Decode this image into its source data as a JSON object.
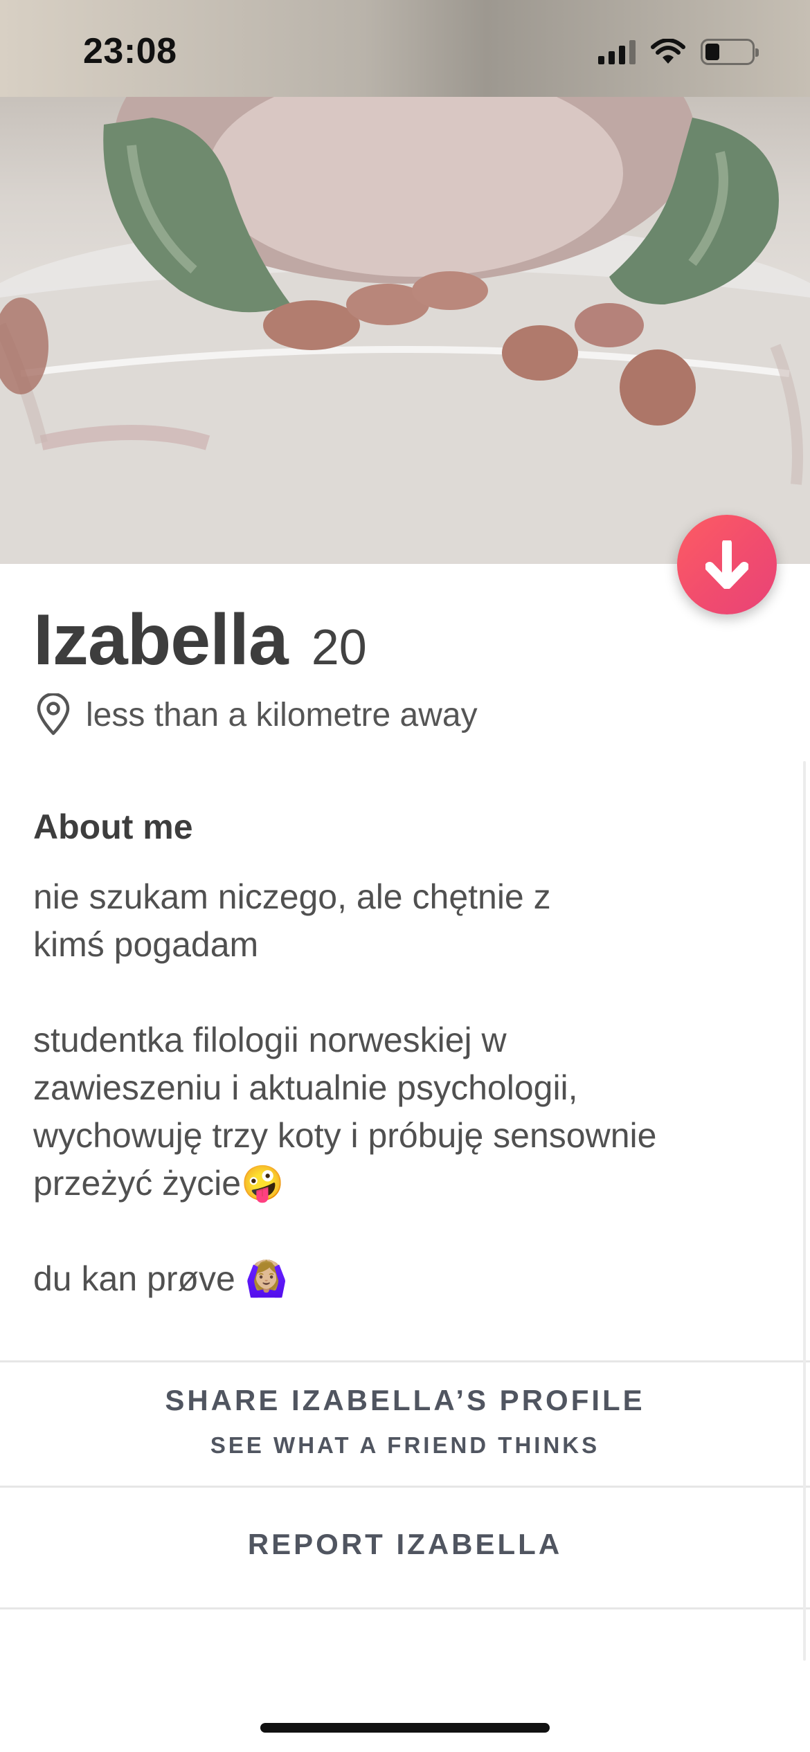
{
  "status_bar": {
    "time": "23:08",
    "icons": [
      "cellular-signal-icon",
      "wifi-icon",
      "battery-icon"
    ]
  },
  "profile": {
    "photo": "profile-photo",
    "name": "Izabella",
    "age": "20",
    "distance": "less than a kilometre away",
    "distance_icon": "location-pin-icon",
    "collapse_icon": "arrow-down-icon",
    "accent_color": "#FD5068"
  },
  "about": {
    "heading": "About me",
    "bio": "nie szukam niczego, ale chętnie z\nkimś pogadam\n\nstudentka filologii norweskiej w\nzawieszeniu i aktualnie psychologii,\nwychowuję trzy koty i próbuję sensownie\nprzeżyć życie🤪\n\ndu kan prøve 🙆🏼‍♀️"
  },
  "actions": {
    "share_label": "SHARE IZABELLA’S PROFILE",
    "share_sublabel": "SEE WHAT A FRIEND THINKS",
    "report_label": "REPORT IZABELLA"
  }
}
